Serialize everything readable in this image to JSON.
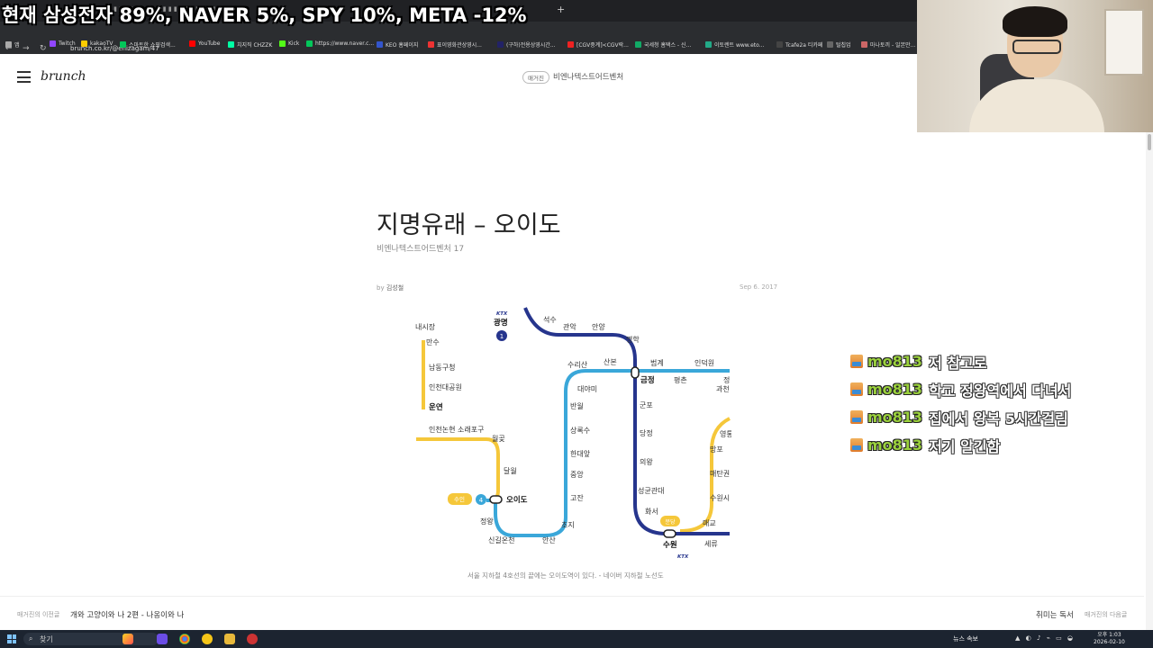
{
  "overlay": {
    "text": "현재 삼성전자 89%, NAVER 5%, SPY 10%, META -12%"
  },
  "browser": {
    "url": "brunch.co.kr/@enizagam/47",
    "bookmarks": [
      "앱",
      "Twitch",
      "kakaoTV",
      "스마트한 쇼핑검색...",
      "YouTube",
      "치지직 CHZZK",
      "Kick",
      "https://www.naver.c...",
      "KEO 홈페이지",
      "표이영화관상영시...",
      "(구하)전용상영시간...",
      "[CGV중계]<CGV락...",
      "국세청 홈택스 - 신...",
      "이토렌트 www.eto...",
      "Tcafe2a 티카페",
      "털칩업",
      "마나토끼 - 일본만..."
    ]
  },
  "header": {
    "logo": "brunch",
    "magazine_tag": "매거진",
    "magazine_name": "비엔나텍스트어드벤처"
  },
  "article": {
    "title": "지명유래 – 오이도",
    "subtitle": "비엔나텍스트어드벤처 17",
    "by_prefix": "by",
    "author": "김성철",
    "date": "Sep 6. 2017",
    "caption": "서울 지하철 4호선의 끝에는 오이도역이 있다. - 네이버 지하철 노선도"
  },
  "subway_map": {
    "labels": {
      "gwangmyeong": "광명",
      "seoksu": "석수",
      "gwanak": "관악",
      "anyang": "안양",
      "myeonghak": "명학",
      "naesijang": "내시장",
      "mansu": "만수",
      "namdong": "남동구청",
      "incheon_park": "인천대공원",
      "unyeon": "운연",
      "incheon_nonhyeon": "인천논현",
      "sorae": "소래포구",
      "wolgot": "월곶",
      "dalwol": "달월",
      "oido": "오이도",
      "jeongwang": "정왕",
      "singil": "신길온천",
      "ansan": "안산",
      "choji": "초지",
      "gojan": "고잔",
      "jungang": "중앙",
      "handae": "한대앞",
      "sangroksu": "상록수",
      "banwol": "반월",
      "daeyami": "대야미",
      "surisan": "수리산",
      "sanbon": "산본",
      "geumjeong": "금정",
      "beomgye": "범계",
      "pyeongchon": "평촌",
      "indeogwon": "인덕원",
      "gunpo": "군포",
      "dangjeong": "당정",
      "uiwang": "의왕",
      "seonggyungwan": "성균관대",
      "hwaseo": "화서",
      "suwon": "수원",
      "seryu": "세류",
      "maegyo": "매교",
      "suwonsi": "수원시",
      "maetan": "매탄권",
      "mangpo": "망포",
      "yeongtong": "영통",
      "jeong": "정",
      "gwacheon": "과천",
      "line4_badge": "4",
      "line1_badge": "1",
      "susin_badge": "수인",
      "bundang_badge": "분당",
      "ktx": "KTX",
      "ktx2": "KTX"
    }
  },
  "chat": [
    {
      "user": "mo813",
      "message": "저 참고로"
    },
    {
      "user": "mo813",
      "message": "학교 정왕역에서 다녀서"
    },
    {
      "user": "mo813",
      "message": "집에서 왕복 5시간걸림"
    },
    {
      "user": "mo813",
      "message": "저기 알긴함"
    }
  ],
  "footer": {
    "prev_label": "매거진의 이전글",
    "prev_title": "개와 고양이와 나 2편 - 나옹이와 나",
    "next_title": "취미는 독서",
    "next_label": "매거진의 다음글"
  },
  "taskbar": {
    "search": "찾기",
    "news": "뉴스 속보",
    "time": "오후 1:03",
    "date": "2026-02-10"
  },
  "colors": {
    "line4": "#3aa7d9",
    "line1": "#26358d",
    "suin": "#f5c73a"
  }
}
